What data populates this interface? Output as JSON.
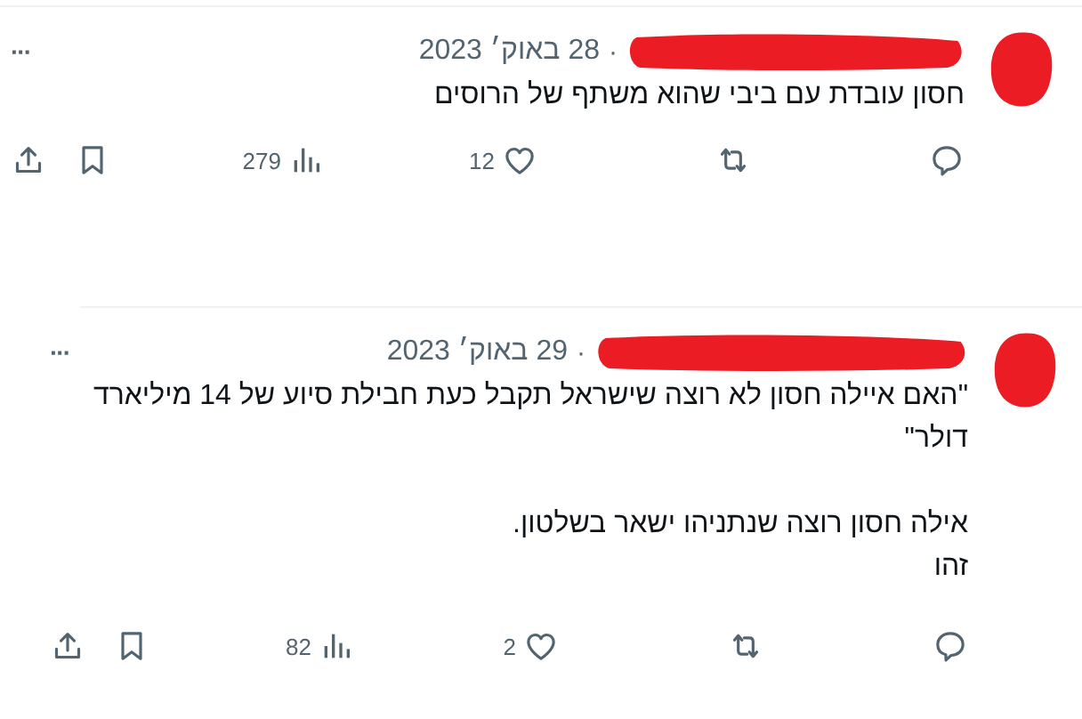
{
  "tweets": [
    {
      "date": "28 באוק׳ 2023",
      "separator": "·",
      "more": "···",
      "paragraphs": [
        "חסון עובדת עם ביבי שהוא משתף של הרוסים"
      ],
      "likes": "12",
      "views": "279",
      "inset": false
    },
    {
      "date": "29 באוק׳ 2023",
      "separator": "·",
      "more": "···",
      "paragraphs": [
        "\"האם איילה חסון לא רוצה שישראל תקבל כעת חבילת סיוע של 14 מיליארד דולר\"",
        "אילה חסון רוצה שנתניהו ישאר בשלטון.\nזהו"
      ],
      "likes": "2",
      "views": "82",
      "inset": true
    }
  ]
}
